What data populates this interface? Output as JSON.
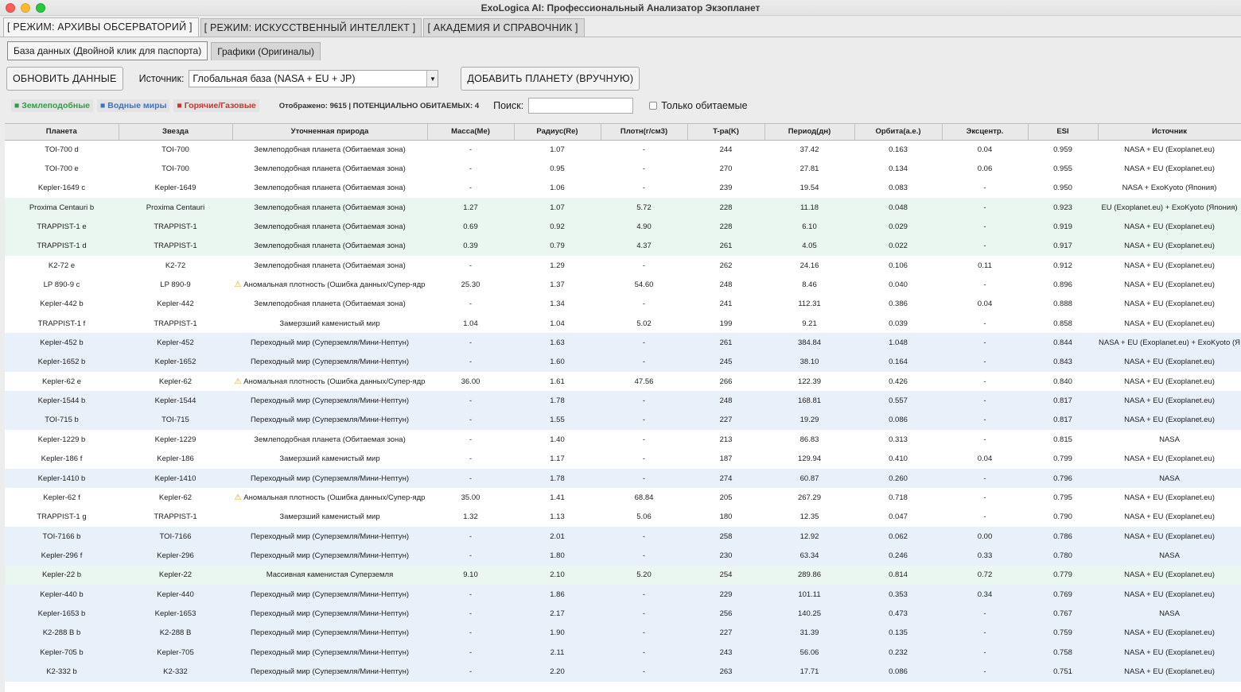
{
  "window": {
    "title": "ExoLogica AI: Профессиональный Анализатор Экзопланет"
  },
  "mode_tabs": [
    {
      "label": "[ РЕЖИМ: АРХИВЫ ОБСЕРВАТОРИЙ ]"
    },
    {
      "label": "[ РЕЖИМ: ИСКУССТВЕННЫЙ ИНТЕЛЛЕКТ ]"
    },
    {
      "label": "[ АКАДЕМИЯ И СПРАВОЧНИК ]"
    }
  ],
  "sub_tabs": [
    {
      "label": "База данных (Двойной клик для паспорта)"
    },
    {
      "label": "Графики (Оригиналы)"
    }
  ],
  "toolbar": {
    "refresh_label": "ОБНОВИТЬ ДАННЫЕ",
    "source_label": "Источник:",
    "source_value": "Глобальная база (NASA + EU + JP)",
    "add_label": "ДОБАВИТЬ ПЛАНЕТУ (ВРУЧНУЮ)"
  },
  "legend": {
    "earth": "■ Землеподобные",
    "water": "■ Водные миры",
    "hot": "■ Горячие/Газовые",
    "count": "Отображено: 9615 | ПОТЕНЦИАЛЬНО ОБИТАЕМЫХ: 4",
    "search_label": "Поиск:",
    "search_value": "",
    "only_habitable": "Только обитаемые"
  },
  "colors": {
    "earth": "#2f9e43",
    "water": "#3c71c8",
    "hot": "#d2302a"
  },
  "table": {
    "headers": [
      "Планета",
      "Звезда",
      "Уточненная природа",
      "Масса(Me)",
      "Радиус(Re)",
      "Плотн(г/см3)",
      "T-ра(K)",
      "Период(дн)",
      "Орбита(а.е.)",
      "Эксцентр.",
      "ESI",
      "Источник"
    ],
    "rows": [
      {
        "kind": "earth",
        "cells": [
          "TOI-700 d",
          "TOI-700",
          "Землеподобная планета (Обитаемая зона)",
          "-",
          "1.07",
          "-",
          "244",
          "37.42",
          "0.163",
          "0.04",
          "0.959",
          "NASA + EU (Exoplanet.eu)"
        ]
      },
      {
        "kind": "earth",
        "cells": [
          "TOI-700 e",
          "TOI-700",
          "Землеподобная планета (Обитаемая зона)",
          "-",
          "0.95",
          "-",
          "270",
          "27.81",
          "0.134",
          "0.06",
          "0.955",
          "NASA + EU (Exoplanet.eu)"
        ]
      },
      {
        "kind": "earth",
        "cells": [
          "Kepler-1649 c",
          "Kepler-1649",
          "Землеподобная планета (Обитаемая зона)",
          "-",
          "1.06",
          "-",
          "239",
          "19.54",
          "0.083",
          "-",
          "0.950",
          "NASA + ExoKyoto (Япония)"
        ]
      },
      {
        "kind": "earthg",
        "cells": [
          "Proxima Centauri b",
          "Proxima Centauri",
          "Землеподобная планета (Обитаемая зона)",
          "1.27",
          "1.07",
          "5.72",
          "228",
          "11.18",
          "0.048",
          "-",
          "0.923",
          "EU (Exoplanet.eu) + ExoKyoto (Япония)"
        ]
      },
      {
        "kind": "earthg",
        "cells": [
          "TRAPPIST-1 e",
          "TRAPPIST-1",
          "Землеподобная планета (Обитаемая зона)",
          "0.69",
          "0.92",
          "4.90",
          "228",
          "6.10",
          "0.029",
          "-",
          "0.919",
          "NASA + EU (Exoplanet.eu)"
        ]
      },
      {
        "kind": "earthg",
        "cells": [
          "TRAPPIST-1 d",
          "TRAPPIST-1",
          "Землеподобная планета (Обитаемая зона)",
          "0.39",
          "0.79",
          "4.37",
          "261",
          "4.05",
          "0.022",
          "-",
          "0.917",
          "NASA + EU (Exoplanet.eu)"
        ]
      },
      {
        "kind": "earth",
        "cells": [
          "K2-72 e",
          "K2-72",
          "Землеподобная планета (Обитаемая зона)",
          "-",
          "1.29",
          "-",
          "262",
          "24.16",
          "0.106",
          "0.11",
          "0.912",
          "NASA + EU (Exoplanet.eu)"
        ]
      },
      {
        "kind": "anom",
        "cells": [
          "LP 890-9 c",
          "LP 890-9",
          "Аномальная плотность (Ошибка данных/Супер-ядр",
          "25.30",
          "1.37",
          "54.60",
          "248",
          "8.46",
          "0.040",
          "-",
          "0.896",
          "NASA + EU (Exoplanet.eu)"
        ]
      },
      {
        "kind": "earth",
        "cells": [
          "Kepler-442 b",
          "Kepler-442",
          "Землеподобная планета (Обитаемая зона)",
          "-",
          "1.34",
          "-",
          "241",
          "112.31",
          "0.386",
          "0.04",
          "0.888",
          "NASA + EU (Exoplanet.eu)"
        ]
      },
      {
        "kind": "cold",
        "cells": [
          "TRAPPIST-1 f",
          "TRAPPIST-1",
          "Замерзший каменистый мир",
          "1.04",
          "1.04",
          "5.02",
          "199",
          "9.21",
          "0.039",
          "-",
          "0.858",
          "NASA + EU (Exoplanet.eu)"
        ]
      },
      {
        "kind": "water",
        "cells": [
          "Kepler-452 b",
          "Kepler-452",
          "Переходный мир (Суперземля/Мини-Нептун)",
          "-",
          "1.63",
          "-",
          "261",
          "384.84",
          "1.048",
          "-",
          "0.844",
          "NASA + EU (Exoplanet.eu) + ExoKyoto (Я"
        ]
      },
      {
        "kind": "water",
        "cells": [
          "Kepler-1652 b",
          "Kepler-1652",
          "Переходный мир (Суперземля/Мини-Нептун)",
          "-",
          "1.60",
          "-",
          "245",
          "38.10",
          "0.164",
          "-",
          "0.843",
          "NASA + EU (Exoplanet.eu)"
        ]
      },
      {
        "kind": "anom",
        "cells": [
          "Kepler-62 e",
          "Kepler-62",
          "Аномальная плотность (Ошибка данных/Супер-ядр",
          "36.00",
          "1.61",
          "47.56",
          "266",
          "122.39",
          "0.426",
          "-",
          "0.840",
          "NASA + EU (Exoplanet.eu)"
        ]
      },
      {
        "kind": "water",
        "cells": [
          "Kepler-1544 b",
          "Kepler-1544",
          "Переходный мир (Суперземля/Мини-Нептун)",
          "-",
          "1.78",
          "-",
          "248",
          "168.81",
          "0.557",
          "-",
          "0.817",
          "NASA + EU (Exoplanet.eu)"
        ]
      },
      {
        "kind": "water",
        "cells": [
          "TOI-715 b",
          "TOI-715",
          "Переходный мир (Суперземля/Мини-Нептун)",
          "-",
          "1.55",
          "-",
          "227",
          "19.29",
          "0.086",
          "-",
          "0.817",
          "NASA + EU (Exoplanet.eu)"
        ]
      },
      {
        "kind": "earth",
        "cells": [
          "Kepler-1229 b",
          "Kepler-1229",
          "Землеподобная планета (Обитаемая зона)",
          "-",
          "1.40",
          "-",
          "213",
          "86.83",
          "0.313",
          "-",
          "0.815",
          "NASA"
        ]
      },
      {
        "kind": "cold",
        "cells": [
          "Kepler-186 f",
          "Kepler-186",
          "Замерзший каменистый мир",
          "-",
          "1.17",
          "-",
          "187",
          "129.94",
          "0.410",
          "0.04",
          "0.799",
          "NASA + EU (Exoplanet.eu)"
        ]
      },
      {
        "kind": "water",
        "cells": [
          "Kepler-1410 b",
          "Kepler-1410",
          "Переходный мир (Суперземля/Мини-Нептун)",
          "-",
          "1.78",
          "-",
          "274",
          "60.87",
          "0.260",
          "-",
          "0.796",
          "NASA"
        ]
      },
      {
        "kind": "anom",
        "cells": [
          "Kepler-62 f",
          "Kepler-62",
          "Аномальная плотность (Ошибка данных/Супер-ядр",
          "35.00",
          "1.41",
          "68.84",
          "205",
          "267.29",
          "0.718",
          "-",
          "0.795",
          "NASA + EU (Exoplanet.eu)"
        ]
      },
      {
        "kind": "cold",
        "cells": [
          "TRAPPIST-1 g",
          "TRAPPIST-1",
          "Замерзший каменистый мир",
          "1.32",
          "1.13",
          "5.06",
          "180",
          "12.35",
          "0.047",
          "-",
          "0.790",
          "NASA + EU (Exoplanet.eu)"
        ]
      },
      {
        "kind": "water",
        "cells": [
          "TOI-7166 b",
          "TOI-7166",
          "Переходный мир (Суперземля/Мини-Нептун)",
          "-",
          "2.01",
          "-",
          "258",
          "12.92",
          "0.062",
          "0.00",
          "0.786",
          "NASA + EU (Exoplanet.eu)"
        ]
      },
      {
        "kind": "water",
        "cells": [
          "Kepler-296 f",
          "Kepler-296",
          "Переходный мир (Суперземля/Мини-Нептун)",
          "-",
          "1.80",
          "-",
          "230",
          "63.34",
          "0.246",
          "0.33",
          "0.780",
          "NASA"
        ]
      },
      {
        "kind": "earthg",
        "cells": [
          "Kepler-22 b",
          "Kepler-22",
          "Массивная каменистая Суперземля",
          "9.10",
          "2.10",
          "5.20",
          "254",
          "289.86",
          "0.814",
          "0.72",
          "0.779",
          "NASA + EU (Exoplanet.eu)"
        ]
      },
      {
        "kind": "water",
        "cells": [
          "Kepler-440 b",
          "Kepler-440",
          "Переходный мир (Суперземля/Мини-Нептун)",
          "-",
          "1.86",
          "-",
          "229",
          "101.11",
          "0.353",
          "0.34",
          "0.769",
          "NASA + EU (Exoplanet.eu)"
        ]
      },
      {
        "kind": "water",
        "cells": [
          "Kepler-1653 b",
          "Kepler-1653",
          "Переходный мир (Суперземля/Мини-Нептун)",
          "-",
          "2.17",
          "-",
          "256",
          "140.25",
          "0.473",
          "-",
          "0.767",
          "NASA"
        ]
      },
      {
        "kind": "water",
        "cells": [
          "K2-288 B b",
          "K2-288 B",
          "Переходный мир (Суперземля/Мини-Нептун)",
          "-",
          "1.90",
          "-",
          "227",
          "31.39",
          "0.135",
          "-",
          "0.759",
          "NASA + EU (Exoplanet.eu)"
        ]
      },
      {
        "kind": "water",
        "cells": [
          "Kepler-705 b",
          "Kepler-705",
          "Переходный мир (Суперземля/Мини-Нептун)",
          "-",
          "2.11",
          "-",
          "243",
          "56.06",
          "0.232",
          "-",
          "0.758",
          "NASA + EU (Exoplanet.eu)"
        ]
      },
      {
        "kind": "water",
        "cells": [
          "K2-332 b",
          "K2-332",
          "Переходный мир (Суперземля/Мини-Нептун)",
          "-",
          "2.20",
          "-",
          "263",
          "17.71",
          "0.086",
          "-",
          "0.751",
          "NASA + EU (Exoplanet.eu)"
        ]
      }
    ]
  }
}
